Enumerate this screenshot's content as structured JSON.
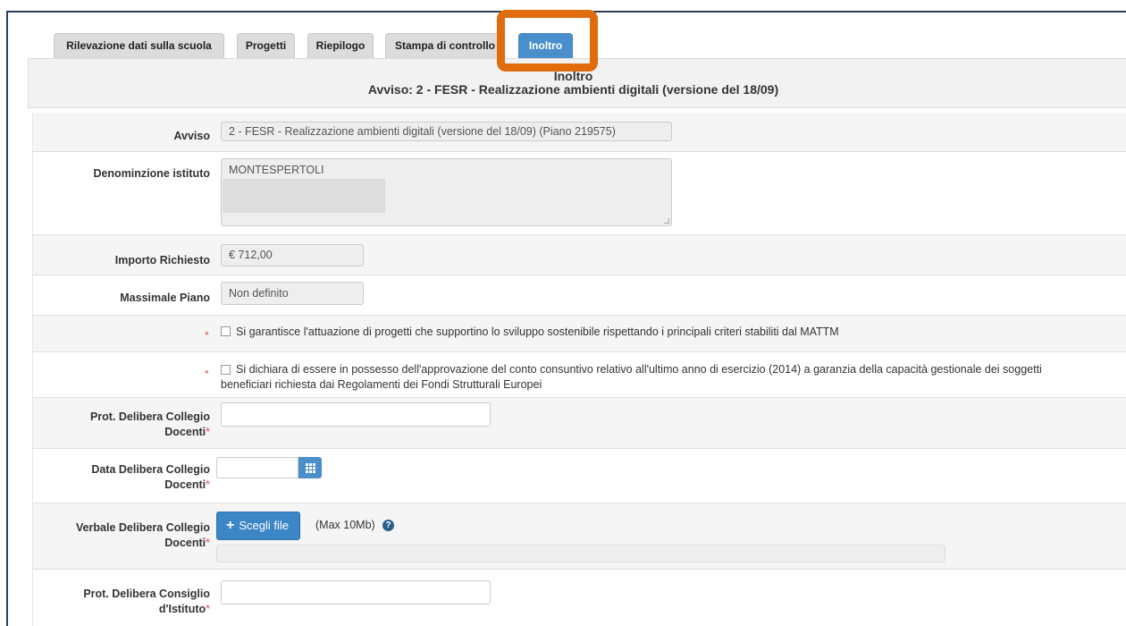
{
  "tabs": [
    {
      "label": "Rilevazione dati sulla scuola"
    },
    {
      "label": "Progetti"
    },
    {
      "label": "Riepilogo"
    },
    {
      "label": "Stampa di controllo"
    },
    {
      "label": "Inoltro"
    }
  ],
  "header": {
    "title": "Inoltro",
    "subtitle": "Avviso: 2 - FESR - Realizzazione ambienti digitali (versione del 18/09)"
  },
  "form": {
    "avviso": {
      "label": "Avviso",
      "value": "2 - FESR - Realizzazione ambienti digitali (versione del 18/09) (Piano 219575)"
    },
    "denominazione": {
      "label": "Denominzione istituto",
      "value": "MONTESPERTOLI"
    },
    "importo": {
      "label": "Importo Richiesto",
      "value": "€ 712,00"
    },
    "massimale": {
      "label": "Massimale Piano",
      "value": "Non definito"
    },
    "check1": {
      "text": "Si garantisce l'attuazione di progetti che supportino lo sviluppo sostenibile rispettando i principali criteri stabiliti dal MATTM"
    },
    "check2": {
      "line1": "Si dichiara di essere in possesso dell'approvazione del conto consuntivo relativo all'ultimo anno di esercizio (2014) a garanzia della capacità gestionale dei soggetti",
      "line2": "beneficiari richiesta dai Regolamenti dei Fondi Strutturali Europei"
    },
    "prot_collegio": {
      "label_line1": "Prot. Delibera Collegio",
      "label_line2": "Docenti"
    },
    "data_collegio": {
      "label_line1": "Data Delibera Collegio",
      "label_line2": "Docenti"
    },
    "verbale_collegio": {
      "label_line1": "Verbale Delibera Collegio",
      "label_line2": "Docenti",
      "button_label": "Scegli file",
      "max_size": "(Max 10Mb)"
    },
    "prot_consiglio": {
      "label_line1": "Prot. Delibera Consiglio",
      "label_line2": "d'Istituto"
    },
    "required_mark": "*"
  },
  "colors": {
    "accent": "#4a8fcb",
    "highlight": "#e06c0e",
    "required": "#d9534f"
  }
}
